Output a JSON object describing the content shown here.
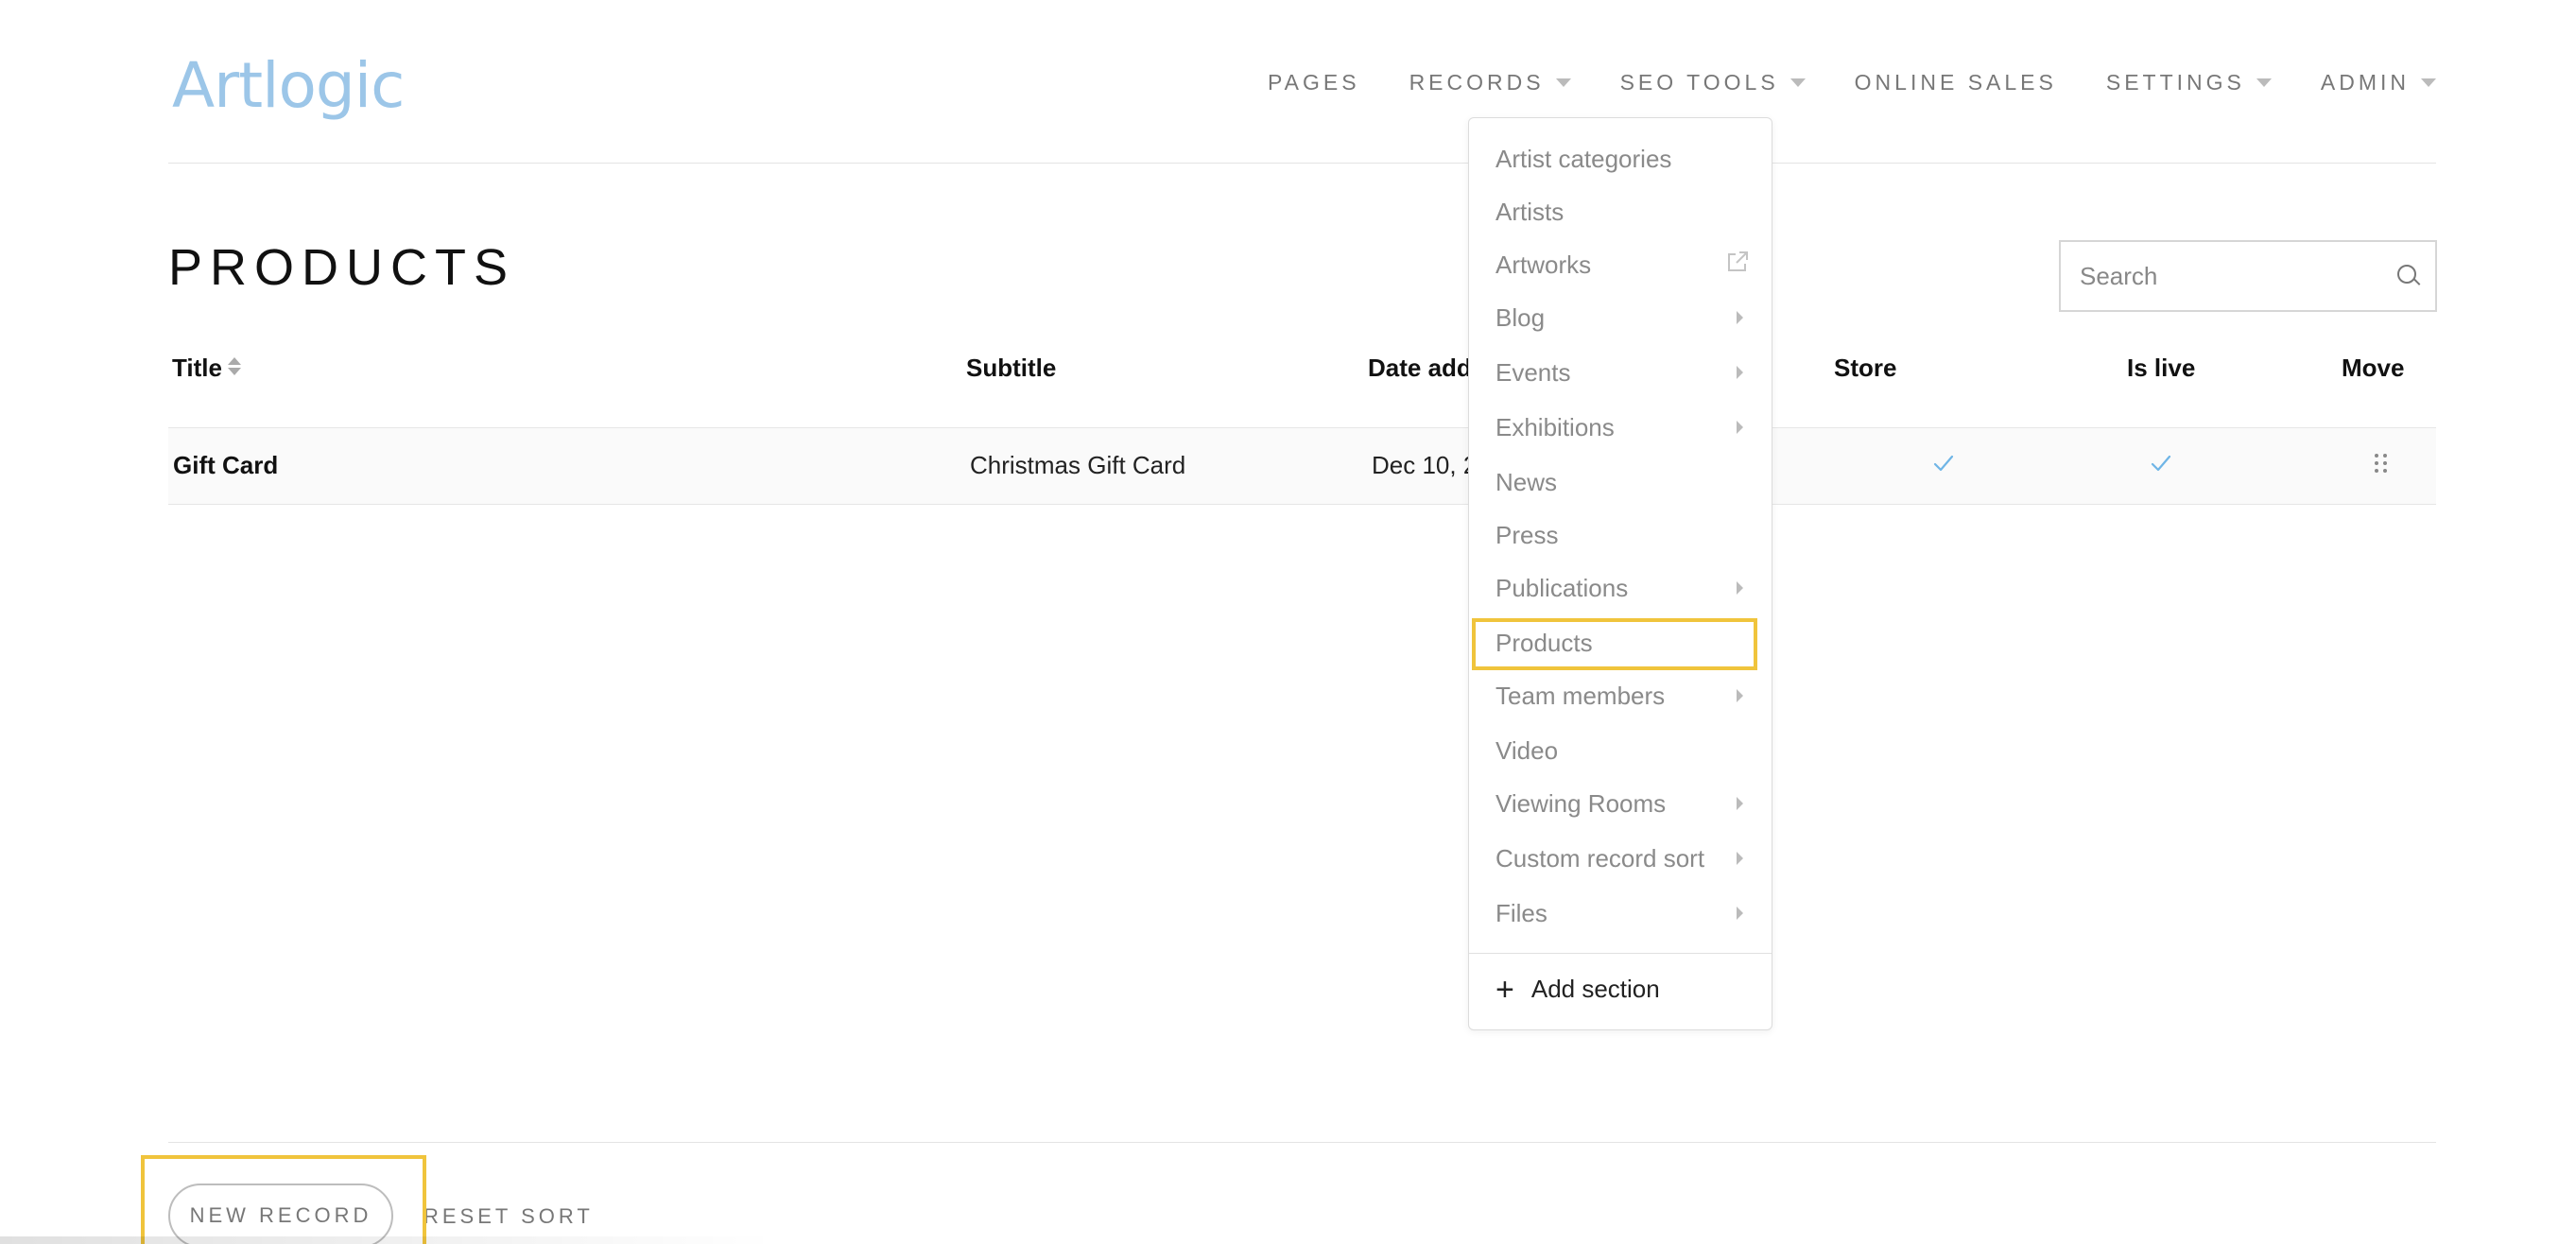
{
  "logo": {
    "text": "Artlogic"
  },
  "nav": {
    "items": [
      {
        "label": "PAGES",
        "caret": false
      },
      {
        "label": "RECORDS",
        "caret": true
      },
      {
        "label": "SEO TOOLS",
        "caret": true
      },
      {
        "label": "ONLINE SALES",
        "caret": false
      },
      {
        "label": "SETTINGS",
        "caret": true
      },
      {
        "label": "ADMIN",
        "caret": true
      }
    ]
  },
  "page": {
    "title": "PRODUCTS"
  },
  "search": {
    "placeholder": "Search"
  },
  "table": {
    "headers": {
      "title": "Title",
      "subtitle": "Subtitle",
      "date_added": "Date add",
      "store": "Store",
      "is_live": "Is live",
      "move": "Move"
    },
    "rows": [
      {
        "title": "Gift Card",
        "subtitle": "Christmas Gift Card",
        "date_added": "Dec 10, 2",
        "store": true,
        "is_live": true
      }
    ]
  },
  "dropdown": {
    "items": [
      {
        "label": "Artist categories"
      },
      {
        "label": "Artists"
      },
      {
        "label": "Artworks",
        "icon": "external-link-icon"
      },
      {
        "label": "Blog",
        "submenu": true
      },
      {
        "label": "Events",
        "submenu": true
      },
      {
        "label": "Exhibitions",
        "submenu": true
      },
      {
        "label": "News"
      },
      {
        "label": "Press"
      },
      {
        "label": "Publications",
        "submenu": true
      },
      {
        "label": "Products",
        "highlighted": true
      },
      {
        "label": "Team members",
        "submenu": true
      },
      {
        "label": "Video"
      },
      {
        "label": "Viewing Rooms",
        "submenu": true
      },
      {
        "label": "Custom record sort",
        "submenu": true
      },
      {
        "label": "Files",
        "submenu": true
      }
    ],
    "add_section_label": "Add section"
  },
  "footer": {
    "new_record_label": "NEW RECORD",
    "reset_sort_label": "RESET SORT"
  },
  "colors": {
    "accent": "#9cc6e8",
    "highlight": "#f0c43c",
    "check": "#6fb5e6"
  }
}
